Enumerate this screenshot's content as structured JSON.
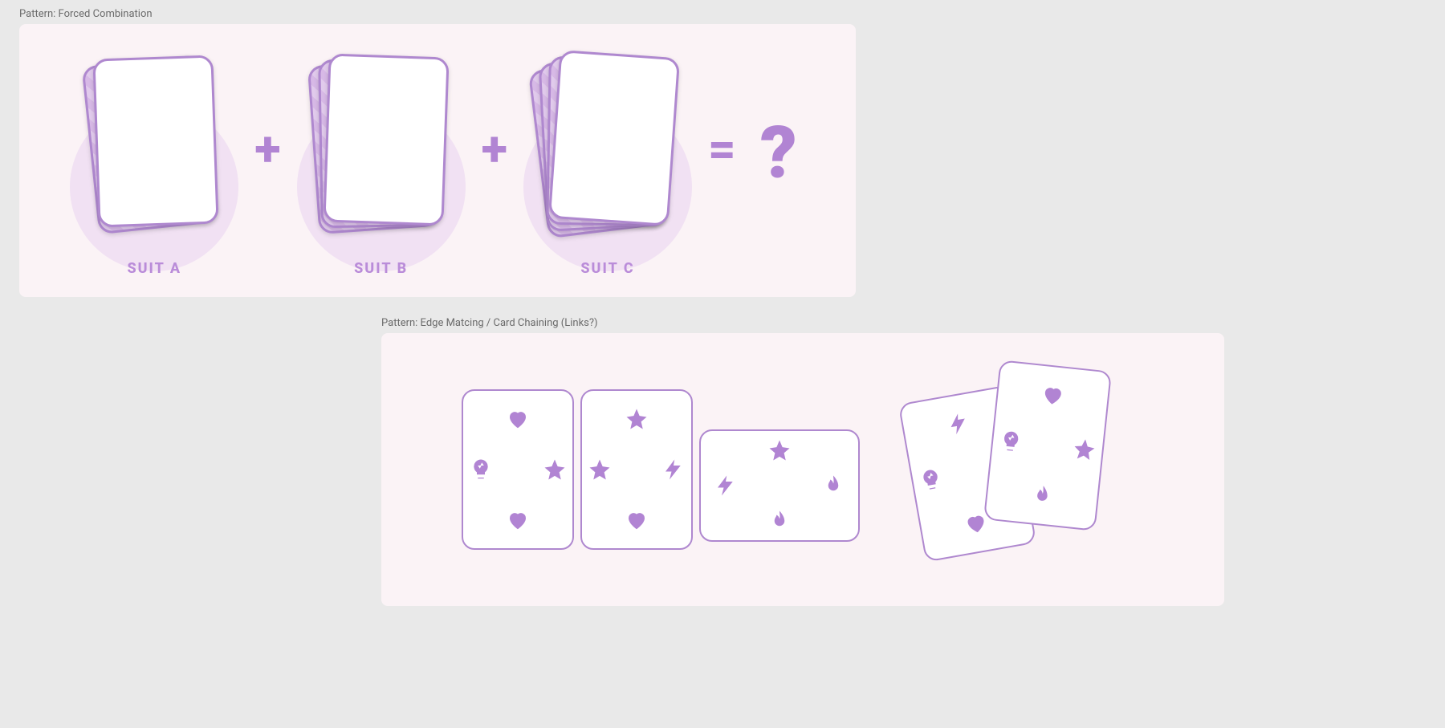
{
  "panel1": {
    "title": "Pattern: Forced Combination",
    "piles": [
      {
        "label": "SUIT A"
      },
      {
        "label": "SUIT B"
      },
      {
        "label": "SUIT C"
      }
    ],
    "plus": "+",
    "equals": "=",
    "result": "?"
  },
  "panel2": {
    "title": "Pattern: Edge Matcing / Card Chaining (Links?)",
    "cards": [
      {
        "orientation": "portrait",
        "edges": {
          "top": "heart",
          "bottom": "heart",
          "left": "bulb",
          "right": "star"
        }
      },
      {
        "orientation": "portrait",
        "edges": {
          "top": "star",
          "bottom": "heart",
          "left": "star",
          "right": "bolt"
        }
      },
      {
        "orientation": "landscape",
        "edges": {
          "top": "star",
          "bottom": "flame",
          "left": "bolt",
          "right": "flame"
        }
      }
    ],
    "overlap_cards": [
      {
        "orientation": "portrait",
        "edges": {
          "top": "bolt",
          "bottom": "heart",
          "left": "bulb",
          "right": "star"
        }
      },
      {
        "orientation": "portrait",
        "edges": {
          "top": "heart",
          "bottom": "flame",
          "left": "bulb",
          "right": "star"
        }
      }
    ]
  },
  "icons": {
    "heart": "heart-icon",
    "star": "star-icon",
    "bolt": "bolt-icon",
    "bulb": "bulb-icon",
    "flame": "flame-icon"
  }
}
